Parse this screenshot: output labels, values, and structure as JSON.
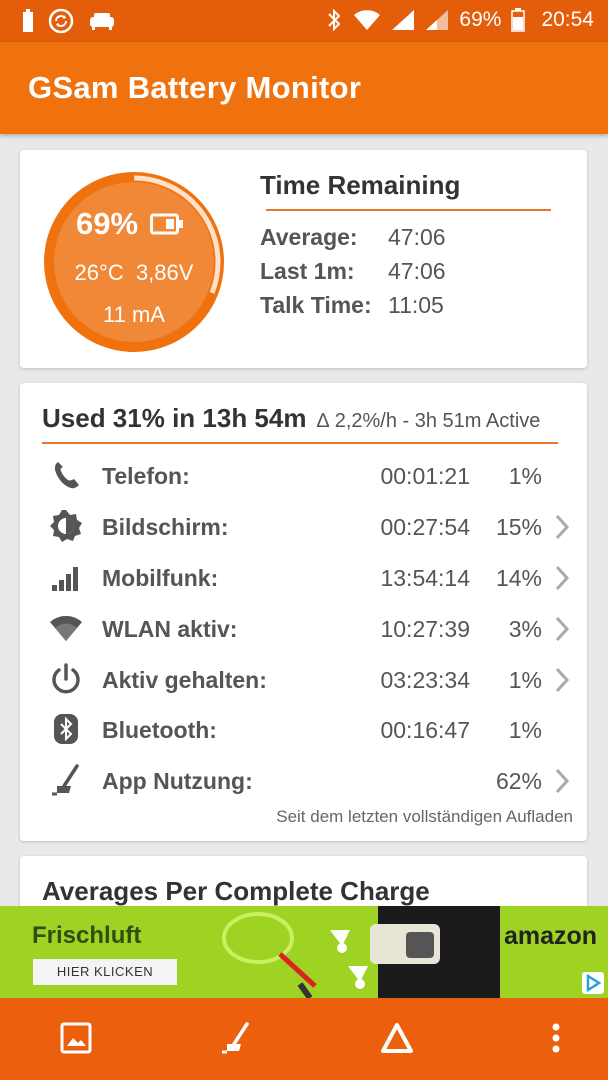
{
  "status_bar": {
    "battery_percent": "69%",
    "time": "20:54"
  },
  "app_bar": {
    "title": "GSam Battery Monitor"
  },
  "battery_card": {
    "percent": "69%",
    "temperature": "26°C",
    "voltage": "3,86V",
    "current": "11 mA",
    "level_fraction": 0.69,
    "time_remaining": {
      "title": "Time Remaining",
      "rows": [
        {
          "label": "Average:",
          "value": "47:06"
        },
        {
          "label": "Last 1m:",
          "value": "47:06"
        },
        {
          "label": "Talk Time:",
          "value": "11:05"
        }
      ]
    }
  },
  "usage_card": {
    "headline": "Used 31% in 13h 54m",
    "subline": "∆ 2,2%/h - 3h 51m Active",
    "rows": [
      {
        "icon": "phone-icon",
        "name": "Telefon:",
        "duration": "00:01:21",
        "percent": "1%",
        "chevron": false
      },
      {
        "icon": "brightness-icon",
        "name": "Bildschirm:",
        "duration": "00:27:54",
        "percent": "15%",
        "chevron": true
      },
      {
        "icon": "signal-bars-icon",
        "name": "Mobilfunk:",
        "duration": "13:54:14",
        "percent": "14%",
        "chevron": true
      },
      {
        "icon": "wifi-icon",
        "name": "WLAN aktiv:",
        "duration": "10:27:39",
        "percent": "3%",
        "chevron": true
      },
      {
        "icon": "power-icon",
        "name": "Aktiv gehalten:",
        "duration": "03:23:34",
        "percent": "1%",
        "chevron": true
      },
      {
        "icon": "bluetooth-icon",
        "name": "Bluetooth:",
        "duration": "00:16:47",
        "percent": "1%",
        "chevron": false
      },
      {
        "icon": "app-usage-icon",
        "name": "App Nutzung:",
        "duration": "",
        "percent": "62%",
        "chevron": true
      }
    ],
    "footnote": "Seit dem letzten vollständigen Aufladen"
  },
  "averages_card": {
    "title": "Averages Per Complete Charge"
  },
  "ad": {
    "brand": "Frischluft",
    "button_label": "HIER KLICKEN",
    "advertiser": "amazon"
  },
  "bottom_bar": {
    "items": [
      "image-icon",
      "app-usage-icon",
      "delta-icon",
      "more-vert-icon"
    ]
  },
  "colors": {
    "status_bar": "#e45d0b",
    "app_bar": "#f0720e",
    "accent": "#e8782a",
    "bottom_bar": "#ec5f0c",
    "ad_background": "#9fd323"
  }
}
